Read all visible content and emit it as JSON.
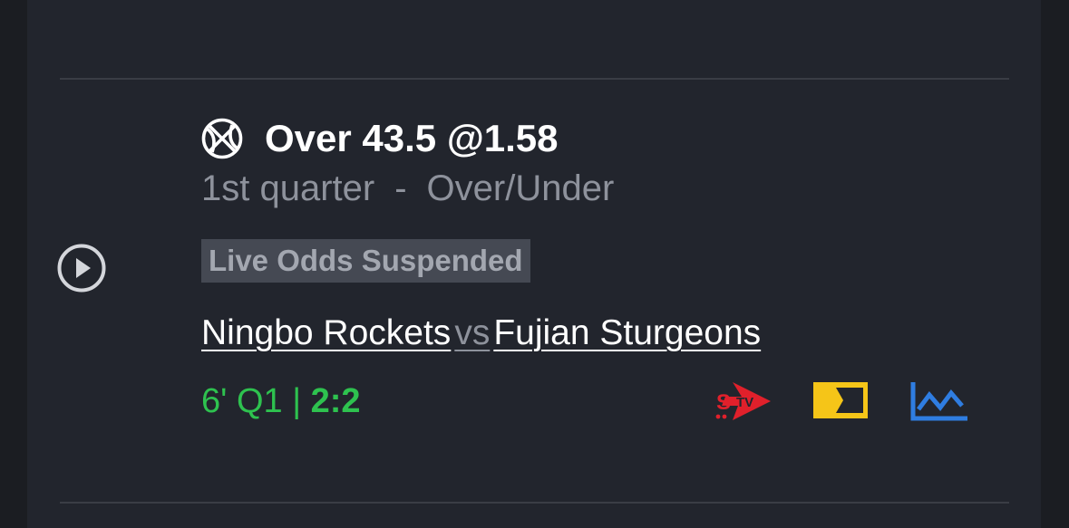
{
  "bet": {
    "selection": "Over 43.5 @1.58",
    "period": "1st quarter",
    "separator": "-",
    "market": "Over/Under",
    "status": "Live Odds Suspended"
  },
  "match": {
    "home_team": "Ningbo Rockets",
    "vs": "vs",
    "away_team": "Fujian Sturgeons",
    "time_period": "6' Q1 |",
    "score": "2:2"
  },
  "icons": {
    "sport": "basketball-icon",
    "play": "play-circle-icon",
    "stream": "stv-icon",
    "tv": "tv-screen-icon",
    "stats": "stats-chart-icon"
  },
  "colors": {
    "live_green": "#2ec24f",
    "stv_red": "#e0202b",
    "tv_yellow": "#f5c518",
    "stats_blue": "#2f7de1"
  }
}
